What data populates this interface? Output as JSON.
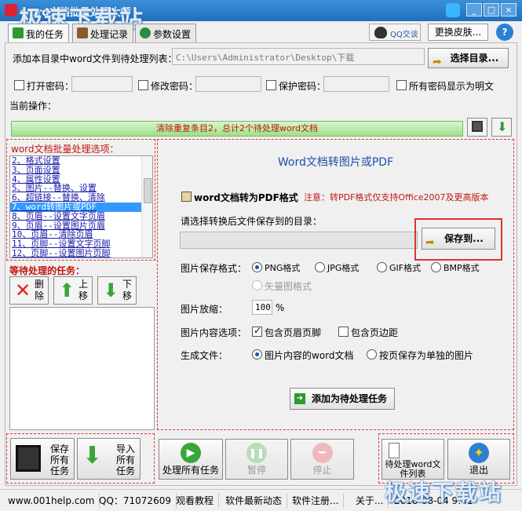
{
  "window": {
    "title": "word文档批量处理大师",
    "watermark": "极速下载站",
    "buttons": [
      "_",
      "□",
      "×"
    ]
  },
  "tabs": [
    {
      "label": "我的任务"
    },
    {
      "label": "处理记录"
    },
    {
      "label": "参数设置"
    }
  ],
  "header": {
    "qq_label": "QQ交谈",
    "skin_label": "更换皮肤...",
    "help_label": "?"
  },
  "dir": {
    "label": "添加本目录中word文件到待处理列表：",
    "value": "C:\\Users\\Administrator\\Desktop\\下载",
    "button": "选择目录..."
  },
  "passwords": {
    "open": "打开密码：",
    "modify": "修改密码：",
    "protect": "保护密码：",
    "show_all": "所有密码显示为明文"
  },
  "current_op": {
    "label": "当前操作：",
    "progress_text": "清除重复条目2，总计2个待处理word文档"
  },
  "options": {
    "title": "word文档批量处理选项：",
    "items": [
      "2、格式设置",
      "3、页面设置",
      "4、属性设置",
      "5、图片--替换、设置",
      "6、超链接--替换、清除",
      "7、word转图片或PDF",
      "8、页眉--设置文字页眉",
      "9、页眉--设置图片页眉",
      "10、页眉--清除页眉",
      "11、页脚--设置文字页脚",
      "12、页脚--设置图片页脚"
    ],
    "selected_index": 5
  },
  "waiting": {
    "title": "等待处理的任务：",
    "delete": "删除",
    "up": "上移",
    "down": "下移"
  },
  "convert": {
    "title": "Word文档转图片或PDF",
    "pdf_label": "word文档转为PDF格式",
    "pdf_note": "注意：转PDF格式仅支持Office2007及更高版本",
    "save_dir_label": "请选择转换后文件保存到的目录：",
    "save_button": "保存到...",
    "format_label": "图片保存格式：",
    "formats": [
      "PNG格式",
      "JPG格式",
      "GIF格式",
      "BMP格式",
      "矢量图格式"
    ],
    "zoom_label": "图片放缩：",
    "zoom_value": "100",
    "zoom_unit": "%",
    "content_label": "图片内容选项：",
    "include_header": "包含页眉页脚",
    "include_margin": "包含页边距",
    "gen_label": "生成文件：",
    "gen_opt1": "图片内容的word文档",
    "gen_opt2": "按页保存为单独的图片",
    "add_button": "添加为待处理任务"
  },
  "bottom": {
    "save_all": "保存所有任务",
    "import_all": "导入所有任务",
    "process_all": "处理所有任务",
    "pause": "暂停",
    "stop": "停止",
    "list": "待处理word文件列表",
    "exit": "退出"
  },
  "status": {
    "site": "www.001help.com",
    "qq": "QQ：71072609",
    "tutorial": "观看教程",
    "news": "软件最新动态",
    "register": "软件注册...",
    "about": "关于...",
    "datetime": "2018-08-04  9:41"
  }
}
